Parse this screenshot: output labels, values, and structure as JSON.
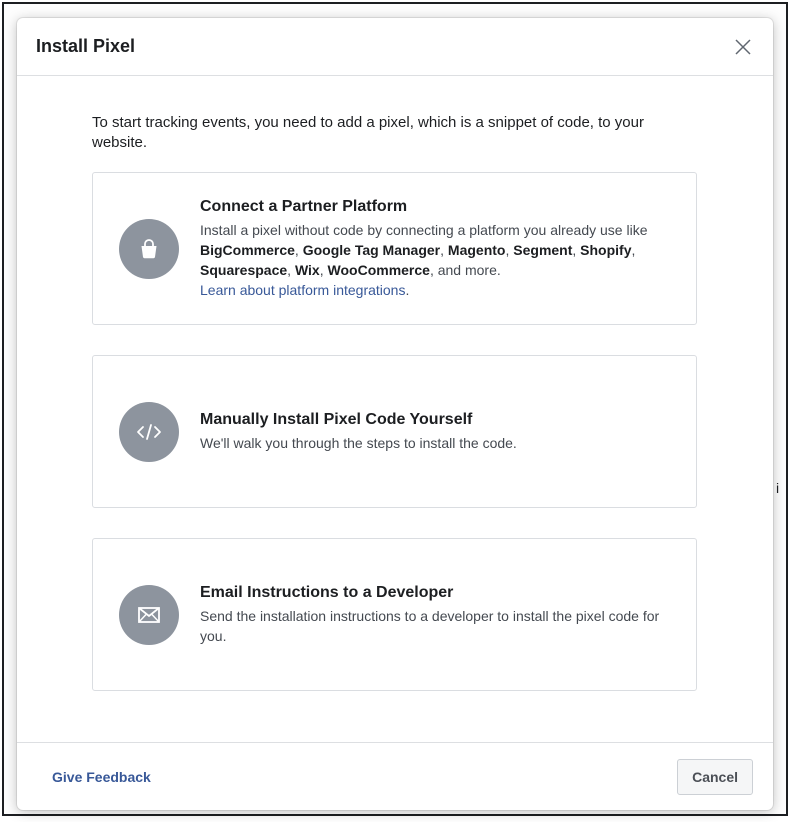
{
  "modal": {
    "title": "Install Pixel",
    "intro": "To start tracking events, you need to add a pixel, which is a snippet of code, to your website."
  },
  "options": [
    {
      "title": "Connect a Partner Platform",
      "desc_prefix": "Install a pixel without code by connecting a platform you already use like ",
      "platforms": [
        "BigCommerce",
        "Google Tag Manager",
        "Magento",
        "Segment",
        "Shopify",
        "Squarespace",
        "Wix",
        "WooCommerce"
      ],
      "desc_suffix": ", and more.",
      "link": "Learn about platform integrations",
      "link_suffix": ".",
      "icon": "shopping-bag-icon"
    },
    {
      "title": "Manually Install Pixel Code Yourself",
      "desc": "We'll walk you through the steps to install the code.",
      "icon": "code-icon"
    },
    {
      "title": "Email Instructions to a Developer",
      "desc": "Send the installation instructions to a developer to install the pixel code for you.",
      "icon": "envelope-icon"
    }
  ],
  "footer": {
    "feedback": "Give Feedback",
    "cancel": "Cancel"
  },
  "colors": {
    "link": "#385898",
    "icon_bg": "#8d949e",
    "border": "#dadde1"
  }
}
